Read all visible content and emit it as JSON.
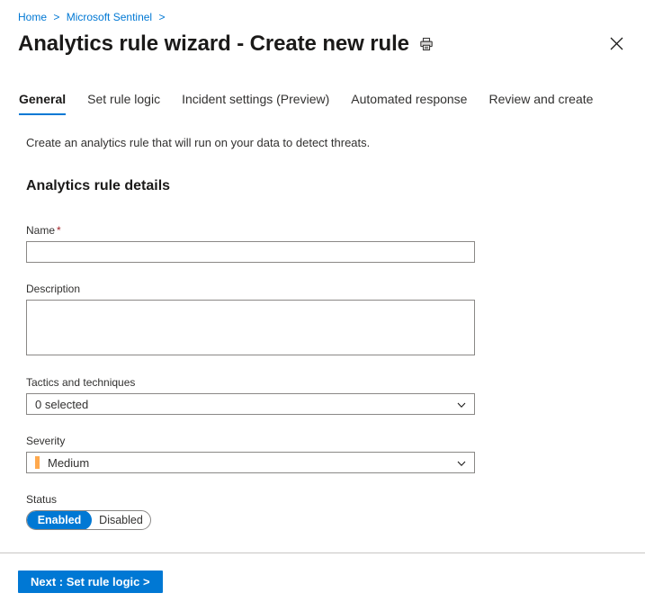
{
  "breadcrumb": {
    "items": [
      {
        "label": "Home"
      },
      {
        "label": "Microsoft Sentinel"
      }
    ],
    "separator": ">",
    "trailing_separator": ">",
    "link_color": "#0078d4"
  },
  "header": {
    "title": "Analytics rule wizard - Create new rule",
    "print_icon": "printer-icon",
    "close_icon": "close-icon"
  },
  "tabs": [
    {
      "label": "General",
      "active": true
    },
    {
      "label": "Set rule logic",
      "active": false
    },
    {
      "label": "Incident settings (Preview)",
      "active": false
    },
    {
      "label": "Automated response",
      "active": false
    },
    {
      "label": "Review and create",
      "active": false
    }
  ],
  "main": {
    "intro_text": "Create an analytics rule that will run on your data to detect threats.",
    "section_heading": "Analytics rule details",
    "fields": {
      "name": {
        "label": "Name",
        "required_marker": "*",
        "value": "",
        "placeholder": ""
      },
      "description": {
        "label": "Description",
        "value": "",
        "placeholder": ""
      },
      "tactics": {
        "label": "Tactics and techniques",
        "value": "0 selected",
        "chevron_icon": "chevron-down-icon"
      },
      "severity": {
        "label": "Severity",
        "value": "Medium",
        "swatch_color": "#FFA94D",
        "chevron_icon": "chevron-down-icon"
      },
      "status": {
        "label": "Status",
        "options": [
          {
            "label": "Enabled",
            "selected": true
          },
          {
            "label": "Disabled",
            "selected": false
          }
        ],
        "selected_color": "#0078d4"
      }
    }
  },
  "footer": {
    "next_label": "Next : Set rule logic >",
    "accent_color": "#0078d4"
  }
}
